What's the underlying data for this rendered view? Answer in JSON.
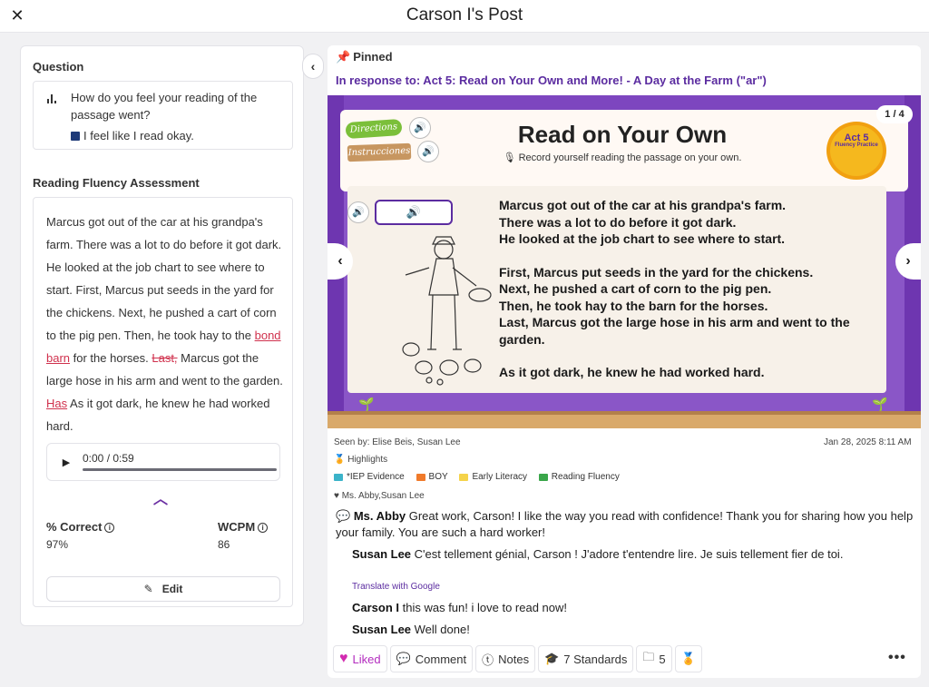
{
  "header": {
    "title": "Carson I's Post",
    "close_icon": "close-icon"
  },
  "left": {
    "question_label": "Question",
    "question_text": "How do you feel your reading of the passage went?",
    "answer_text": "I feel like I read okay.",
    "rfa_label": "Reading Fluency Assessment",
    "passage": {
      "p1": "Marcus got out of the car at his grandpa's farm. There was a lot to do before it got dark. He looked at the job chart to see where to start. First, Marcus put seeds in the yard for the chickens. Next, he pushed a cart of corn to the pig pen. Then, he took hay to the ",
      "err1": "bond",
      "err2": "barn",
      "p2": " for the horses. ",
      "strike1": "Last,",
      "p3": " Marcus got the large hose in his arm and went to the garden. ",
      "err3": "Has",
      "p4": " As it got dark, he knew he had worked hard."
    },
    "audio_time": "0:00 / 0:59",
    "audio_progress": 0,
    "pct_correct_label": "% Correct",
    "pct_correct_value": "97%",
    "wcpm_label": "WCPM",
    "wcpm_value": "86",
    "edit_label": "Edit"
  },
  "right": {
    "pinned_label": "Pinned",
    "in_response": "In response to: Act 5: Read on Your Own and More! - A Day at the Farm (\"ar\")",
    "activity": {
      "directions": "Directions",
      "instrucciones": "Instrucciones",
      "title": "Read on Your Own",
      "subtitle": "Record yourself reading the passage on your own.",
      "page": "1 / 4",
      "badge_act": "Act 5",
      "badge_sub": "Fluency Practice",
      "lines": [
        "Marcus got out of the car at his grandpa's farm.",
        "There was a lot to do before it got dark.",
        "He looked at the job chart to see where to start."
      ],
      "lines2": [
        "First, Marcus put seeds in the yard for the chickens.",
        "Next, he pushed a cart of corn to the pig pen.",
        "Then, he took hay to the barn for the horses.",
        "Last, Marcus got the large hose in his arm and went to the garden."
      ],
      "lines3": "As it got dark, he knew he had worked hard."
    },
    "seen_by": "Seen by: Elise Beis, Susan Lee",
    "date": "Jan 28, 2025 8:11 AM",
    "highlights_label": "Highlights",
    "tags": [
      {
        "label": "*IEP Evidence",
        "color": "#3bb3c9"
      },
      {
        "label": "BOY",
        "color": "#f07a2a"
      },
      {
        "label": "Early Literacy",
        "color": "#f5d34a"
      },
      {
        "label": "Reading Fluency",
        "color": "#3aa64a"
      }
    ],
    "likes_text": "Ms. Abby,Susan Lee",
    "comments": [
      {
        "author": "Ms. Abby",
        "text": " Great work, Carson! I like the way you read with confidence! Thank you for sharing how you help your family. You are such a hard worker!"
      },
      {
        "author": "Susan Lee",
        "text": " C'est tellement génial, Carson ! J'adore t'entendre lire. Je suis tellement fier de toi."
      },
      {
        "author": "Carson I",
        "text": " this was fun! i love to read now!"
      },
      {
        "author": "Susan Lee",
        "text": " Well done!"
      }
    ],
    "translate": "Translate with Google",
    "actions": {
      "liked": "Liked",
      "comment": "Comment",
      "notes": "Notes",
      "standards": "7 Standards",
      "folder_count": "5"
    }
  }
}
